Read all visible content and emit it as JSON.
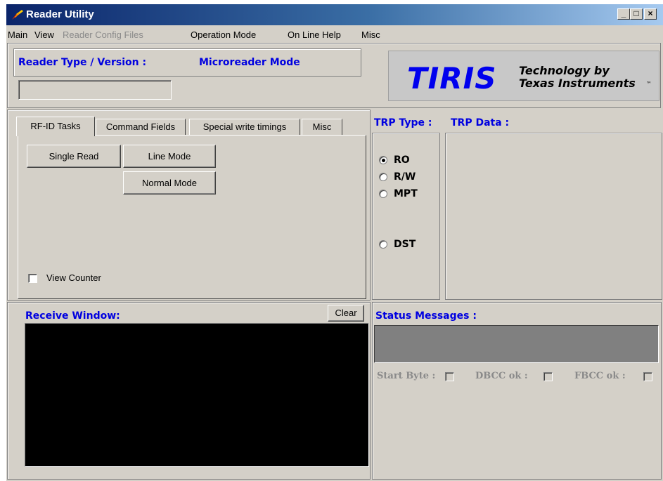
{
  "window": {
    "title": "Reader Utility",
    "controls": [
      "_",
      "□",
      "×"
    ]
  },
  "menu": [
    {
      "label": "Main",
      "enabled": true
    },
    {
      "label": "View",
      "enabled": true
    },
    {
      "label": "Reader Config Files",
      "enabled": false
    },
    {
      "label": "Operation Mode",
      "enabled": true
    },
    {
      "label": "On Line Help",
      "enabled": true
    },
    {
      "label": "Misc",
      "enabled": true
    }
  ],
  "reader": {
    "type_label": "Reader Type / Version :",
    "mode_label": "Microreader Mode",
    "version_value": ""
  },
  "logo": {
    "brand": "TIRIS",
    "line1": "Technology by",
    "line2": "Texas Instruments",
    "tm": "™"
  },
  "tabs": [
    {
      "label": "RF-ID Tasks",
      "active": true
    },
    {
      "label": "Command Fields",
      "active": false
    },
    {
      "label": "Special write timings",
      "active": false
    },
    {
      "label": "Misc",
      "active": false
    }
  ],
  "tasks": {
    "single_read": "Single Read",
    "line_mode": "Line Mode",
    "normal_mode": "Normal Mode",
    "view_counter": "View Counter",
    "view_counter_checked": false
  },
  "trp": {
    "type_label": "TRP Type :",
    "data_label": "TRP Data :",
    "options": [
      {
        "label": "RO",
        "selected": true
      },
      {
        "label": "R/W",
        "selected": false
      },
      {
        "label": "MPT",
        "selected": false
      },
      {
        "label": "DST",
        "selected": false
      }
    ]
  },
  "receive": {
    "label": "Receive Window:",
    "clear": "Clear"
  },
  "status": {
    "label": "Status Messages :",
    "start_byte": "Start Byte :",
    "dbcc": "DBCC ok :",
    "fbcc": "FBCC ok :"
  },
  "colors": {
    "face": "#d4d0c8",
    "accent_blue": "#0000e0",
    "terminal": "#000000",
    "status_box": "#808080"
  }
}
